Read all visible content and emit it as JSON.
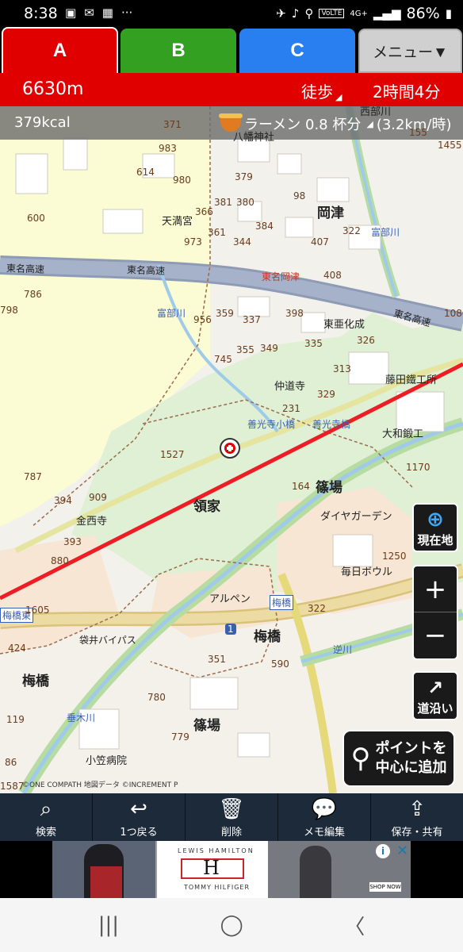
{
  "status": {
    "time": "8:38",
    "battery": "86%",
    "network": "4G+",
    "volte": "VoLTE"
  },
  "tabs": {
    "a": "A",
    "b": "B",
    "c": "C",
    "menu": "メニュー▼"
  },
  "route": {
    "distance": "6630m",
    "mode": "徒歩",
    "duration": "2時間4分"
  },
  "info": {
    "kcal": "379kcal",
    "ramen": "ラーメン 0.8 杯分",
    "speed": "(3.2km/h)",
    "speed_unit": "(3.2km/時)"
  },
  "map": {
    "places": [
      "岡津",
      "篠場",
      "領家",
      "梅橋",
      "梅橋",
      "篠場",
      "梅橋"
    ],
    "labels": {
      "okatsu": "岡津",
      "shinoba1": "篠場",
      "ryoke": "領家",
      "umehashi1": "梅橋",
      "umehashi2": "梅橋",
      "shinoba2": "篠場",
      "tomei1": "東名高速",
      "tomei2": "東名高速",
      "tomei3": "東名高速",
      "tomei_okatsu": "東名岡津",
      "tenmangu": "天満宮",
      "hachiman": "八幡神社",
      "tomibegawa1": "富部川",
      "tomibegawa2": "富部川",
      "toakasei": "東亜化成",
      "chudoji": "仲道寺",
      "zenkoji_kobashi": "善光寺小橋",
      "zenkoji_bashi": "善光寺橋",
      "fujita": "藤田鐵工所",
      "yamato": "大和鍛工",
      "daiya": "ダイヤガーデン",
      "mainichi": "毎日ボウル",
      "arupen": "アルペン",
      "fukuroi_bypass": "袋井バイパス",
      "umehashi_sign": "梅橋",
      "ryoke_sign": "領家",
      "umehashi_east": "梅橋東",
      "kasahara": "小笠病院",
      "shigekigawa": "垂木川",
      "sakasagawa": "逆川",
      "konzeji": "金西寺",
      "nishi": "西部川",
      "route1": "1"
    },
    "numbers": [
      "371",
      "983",
      "614",
      "980",
      "379",
      "381",
      "380",
      "366",
      "98",
      "600",
      "384",
      "361",
      "344",
      "973",
      "407",
      "322",
      "786",
      "408",
      "398",
      "359",
      "337",
      "956",
      "398",
      "335",
      "355",
      "349",
      "326",
      "745",
      "313",
      "329",
      "231",
      "1527",
      "787",
      "394",
      "909",
      "164",
      "1170",
      "1250",
      "322",
      "880",
      "393",
      "1605",
      "424",
      "590",
      "780",
      "351",
      "779",
      "119",
      "1455",
      "1080",
      "798",
      "86",
      "155",
      "1587"
    ],
    "copyright": "©ONE COMPATH 地図データ ©INCREMENT P"
  },
  "controls": {
    "current_location": "現在地",
    "zoom_in": "+",
    "zoom_out": "−",
    "along_road": "道沿い",
    "add_point_line1": "ポイントを",
    "add_point_line2": "中心に追加"
  },
  "toolbar": {
    "search": "検索",
    "back": "1つ戻る",
    "delete": "削除",
    "memo": "メモ編集",
    "save": "保存・共有"
  },
  "ad": {
    "brand_top": "LEWIS HAMILTON",
    "brand_bottom": "TOMMY HILFIGER",
    "logo": "H",
    "cta": "SHOP NOW",
    "info": "i",
    "close": "✕"
  },
  "colors": {
    "tab_a": "#e00000",
    "tab_b": "#33a021",
    "tab_c": "#2a7ff0",
    "route_line": "#ee1c24",
    "toolbar_bg": "#1c2a3a"
  }
}
